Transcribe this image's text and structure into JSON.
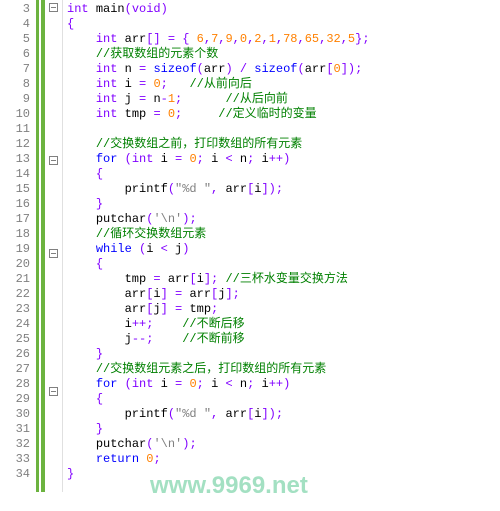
{
  "lines": [
    {
      "n": "3",
      "fold": true,
      "seg": [
        {
          "t": "typ",
          "v": "int "
        },
        {
          "t": "fn",
          "v": "main"
        },
        {
          "t": "op",
          "v": "("
        },
        {
          "t": "typ",
          "v": "void"
        },
        {
          "t": "op",
          "v": ")"
        }
      ]
    },
    {
      "n": "4",
      "seg": [
        {
          "t": "op",
          "v": "{"
        }
      ]
    },
    {
      "n": "5",
      "ind": 1,
      "seg": [
        {
          "t": "typ",
          "v": "int "
        },
        {
          "t": "fn",
          "v": "arr"
        },
        {
          "t": "op",
          "v": "[] = { "
        },
        {
          "t": "num",
          "v": "6"
        },
        {
          "t": "op",
          "v": ","
        },
        {
          "t": "num",
          "v": "7"
        },
        {
          "t": "op",
          "v": ","
        },
        {
          "t": "num",
          "v": "9"
        },
        {
          "t": "op",
          "v": ","
        },
        {
          "t": "num",
          "v": "0"
        },
        {
          "t": "op",
          "v": ","
        },
        {
          "t": "num",
          "v": "2"
        },
        {
          "t": "op",
          "v": ","
        },
        {
          "t": "num",
          "v": "1"
        },
        {
          "t": "op",
          "v": ","
        },
        {
          "t": "num",
          "v": "78"
        },
        {
          "t": "op",
          "v": ","
        },
        {
          "t": "num",
          "v": "65"
        },
        {
          "t": "op",
          "v": ","
        },
        {
          "t": "num",
          "v": "32"
        },
        {
          "t": "op",
          "v": ","
        },
        {
          "t": "num",
          "v": "5"
        },
        {
          "t": "op",
          "v": "};"
        }
      ]
    },
    {
      "n": "6",
      "ind": 1,
      "seg": [
        {
          "t": "cmt",
          "v": "//获取数组的元素个数"
        }
      ]
    },
    {
      "n": "7",
      "ind": 1,
      "seg": [
        {
          "t": "typ",
          "v": "int "
        },
        {
          "t": "fn",
          "v": "n "
        },
        {
          "t": "op",
          "v": "= "
        },
        {
          "t": "kw",
          "v": "sizeof"
        },
        {
          "t": "op",
          "v": "("
        },
        {
          "t": "fn",
          "v": "arr"
        },
        {
          "t": "op",
          "v": ") / "
        },
        {
          "t": "kw",
          "v": "sizeof"
        },
        {
          "t": "op",
          "v": "("
        },
        {
          "t": "fn",
          "v": "arr"
        },
        {
          "t": "op",
          "v": "["
        },
        {
          "t": "num",
          "v": "0"
        },
        {
          "t": "op",
          "v": "]);"
        }
      ]
    },
    {
      "n": "8",
      "ind": 1,
      "seg": [
        {
          "t": "typ",
          "v": "int "
        },
        {
          "t": "fn",
          "v": "i "
        },
        {
          "t": "op",
          "v": "= "
        },
        {
          "t": "num",
          "v": "0"
        },
        {
          "t": "op",
          "v": ";   "
        },
        {
          "t": "cmt",
          "v": "//从前向后"
        }
      ]
    },
    {
      "n": "9",
      "ind": 1,
      "seg": [
        {
          "t": "typ",
          "v": "int "
        },
        {
          "t": "fn",
          "v": "j "
        },
        {
          "t": "op",
          "v": "= "
        },
        {
          "t": "fn",
          "v": "n"
        },
        {
          "t": "op",
          "v": "-"
        },
        {
          "t": "num",
          "v": "1"
        },
        {
          "t": "op",
          "v": ";      "
        },
        {
          "t": "cmt",
          "v": "//从后向前"
        }
      ]
    },
    {
      "n": "10",
      "ind": 1,
      "seg": [
        {
          "t": "typ",
          "v": "int "
        },
        {
          "t": "fn",
          "v": "tmp "
        },
        {
          "t": "op",
          "v": "= "
        },
        {
          "t": "num",
          "v": "0"
        },
        {
          "t": "op",
          "v": ";     "
        },
        {
          "t": "cmt",
          "v": "//定义临时的变量"
        }
      ]
    },
    {
      "n": "11",
      "seg": []
    },
    {
      "n": "12",
      "ind": 1,
      "seg": [
        {
          "t": "cmt",
          "v": "//交换数组之前，打印数组的所有元素"
        }
      ]
    },
    {
      "n": "13",
      "ind": 1,
      "fold": true,
      "seg": [
        {
          "t": "kw",
          "v": "for "
        },
        {
          "t": "op",
          "v": "("
        },
        {
          "t": "typ",
          "v": "int "
        },
        {
          "t": "fn",
          "v": "i "
        },
        {
          "t": "op",
          "v": "= "
        },
        {
          "t": "num",
          "v": "0"
        },
        {
          "t": "op",
          "v": "; "
        },
        {
          "t": "fn",
          "v": "i "
        },
        {
          "t": "op",
          "v": "< "
        },
        {
          "t": "fn",
          "v": "n"
        },
        {
          "t": "op",
          "v": "; "
        },
        {
          "t": "fn",
          "v": "i"
        },
        {
          "t": "op",
          "v": "++)"
        }
      ]
    },
    {
      "n": "14",
      "ind": 1,
      "seg": [
        {
          "t": "op",
          "v": "{"
        }
      ]
    },
    {
      "n": "15",
      "ind": 2,
      "seg": [
        {
          "t": "fn",
          "v": "printf"
        },
        {
          "t": "op",
          "v": "("
        },
        {
          "t": "str",
          "v": "\"%d \""
        },
        {
          "t": "op",
          "v": ", "
        },
        {
          "t": "fn",
          "v": "arr"
        },
        {
          "t": "op",
          "v": "["
        },
        {
          "t": "fn",
          "v": "i"
        },
        {
          "t": "op",
          "v": "]);"
        }
      ]
    },
    {
      "n": "16",
      "ind": 1,
      "seg": [
        {
          "t": "op",
          "v": "}"
        }
      ]
    },
    {
      "n": "17",
      "ind": 1,
      "seg": [
        {
          "t": "fn",
          "v": "putchar"
        },
        {
          "t": "op",
          "v": "("
        },
        {
          "t": "str",
          "v": "'\\n'"
        },
        {
          "t": "op",
          "v": ");"
        }
      ]
    },
    {
      "n": "18",
      "ind": 1,
      "seg": [
        {
          "t": "cmt",
          "v": "//循环交换数组元素"
        }
      ]
    },
    {
      "n": "19",
      "ind": 1,
      "fold": true,
      "seg": [
        {
          "t": "kw",
          "v": "while "
        },
        {
          "t": "op",
          "v": "("
        },
        {
          "t": "fn",
          "v": "i "
        },
        {
          "t": "op",
          "v": "< "
        },
        {
          "t": "fn",
          "v": "j"
        },
        {
          "t": "op",
          "v": ")"
        }
      ]
    },
    {
      "n": "20",
      "ind": 1,
      "seg": [
        {
          "t": "op",
          "v": "{"
        }
      ]
    },
    {
      "n": "21",
      "ind": 2,
      "seg": [
        {
          "t": "fn",
          "v": "tmp "
        },
        {
          "t": "op",
          "v": "= "
        },
        {
          "t": "fn",
          "v": "arr"
        },
        {
          "t": "op",
          "v": "["
        },
        {
          "t": "fn",
          "v": "i"
        },
        {
          "t": "op",
          "v": "]; "
        },
        {
          "t": "cmt",
          "v": "//三杯水变量交换方法"
        }
      ]
    },
    {
      "n": "22",
      "ind": 2,
      "seg": [
        {
          "t": "fn",
          "v": "arr"
        },
        {
          "t": "op",
          "v": "["
        },
        {
          "t": "fn",
          "v": "i"
        },
        {
          "t": "op",
          "v": "] = "
        },
        {
          "t": "fn",
          "v": "arr"
        },
        {
          "t": "op",
          "v": "["
        },
        {
          "t": "fn",
          "v": "j"
        },
        {
          "t": "op",
          "v": "];"
        }
      ]
    },
    {
      "n": "23",
      "ind": 2,
      "seg": [
        {
          "t": "fn",
          "v": "arr"
        },
        {
          "t": "op",
          "v": "["
        },
        {
          "t": "fn",
          "v": "j"
        },
        {
          "t": "op",
          "v": "] = "
        },
        {
          "t": "fn",
          "v": "tmp"
        },
        {
          "t": "op",
          "v": ";"
        }
      ]
    },
    {
      "n": "24",
      "ind": 2,
      "seg": [
        {
          "t": "fn",
          "v": "i"
        },
        {
          "t": "op",
          "v": "++;    "
        },
        {
          "t": "cmt",
          "v": "//不断后移"
        }
      ]
    },
    {
      "n": "25",
      "ind": 2,
      "seg": [
        {
          "t": "fn",
          "v": "j"
        },
        {
          "t": "op",
          "v": "--;    "
        },
        {
          "t": "cmt",
          "v": "//不断前移"
        }
      ]
    },
    {
      "n": "26",
      "ind": 1,
      "seg": [
        {
          "t": "op",
          "v": "}"
        }
      ]
    },
    {
      "n": "27",
      "ind": 1,
      "seg": [
        {
          "t": "cmt",
          "v": "//交换数组元素之后，打印数组的所有元素"
        }
      ]
    },
    {
      "n": "28",
      "ind": 1,
      "fold": true,
      "seg": [
        {
          "t": "kw",
          "v": "for "
        },
        {
          "t": "op",
          "v": "("
        },
        {
          "t": "typ",
          "v": "int "
        },
        {
          "t": "fn",
          "v": "i "
        },
        {
          "t": "op",
          "v": "= "
        },
        {
          "t": "num",
          "v": "0"
        },
        {
          "t": "op",
          "v": "; "
        },
        {
          "t": "fn",
          "v": "i "
        },
        {
          "t": "op",
          "v": "< "
        },
        {
          "t": "fn",
          "v": "n"
        },
        {
          "t": "op",
          "v": "; "
        },
        {
          "t": "fn",
          "v": "i"
        },
        {
          "t": "op",
          "v": "++)"
        }
      ]
    },
    {
      "n": "29",
      "ind": 1,
      "seg": [
        {
          "t": "op",
          "v": "{"
        }
      ]
    },
    {
      "n": "30",
      "ind": 2,
      "seg": [
        {
          "t": "fn",
          "v": "printf"
        },
        {
          "t": "op",
          "v": "("
        },
        {
          "t": "str",
          "v": "\"%d \""
        },
        {
          "t": "op",
          "v": ", "
        },
        {
          "t": "fn",
          "v": "arr"
        },
        {
          "t": "op",
          "v": "["
        },
        {
          "t": "fn",
          "v": "i"
        },
        {
          "t": "op",
          "v": "]);"
        }
      ]
    },
    {
      "n": "31",
      "ind": 1,
      "seg": [
        {
          "t": "op",
          "v": "}"
        }
      ]
    },
    {
      "n": "32",
      "ind": 1,
      "seg": [
        {
          "t": "fn",
          "v": "putchar"
        },
        {
          "t": "op",
          "v": "("
        },
        {
          "t": "str",
          "v": "'\\n'"
        },
        {
          "t": "op",
          "v": ");"
        }
      ]
    },
    {
      "n": "33",
      "ind": 1,
      "seg": [
        {
          "t": "kw",
          "v": "return "
        },
        {
          "t": "num",
          "v": "0"
        },
        {
          "t": "op",
          "v": ";"
        }
      ]
    },
    {
      "n": "34",
      "seg": [
        {
          "t": "op",
          "v": "}"
        }
      ]
    }
  ],
  "watermark": "www.9969.net"
}
